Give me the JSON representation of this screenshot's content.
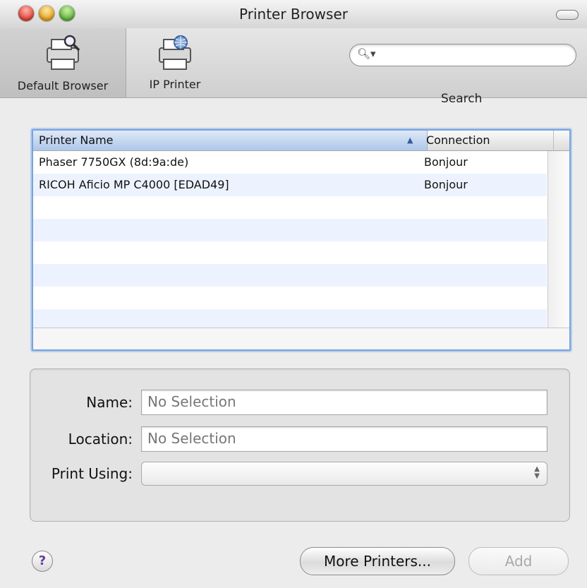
{
  "window": {
    "title": "Printer Browser"
  },
  "toolbar": {
    "default_browser": {
      "label": "Default Browser",
      "icon": "printer-magnifier-icon"
    },
    "ip_printer": {
      "label": "IP Printer",
      "icon": "printer-globe-icon"
    },
    "search": {
      "label": "Search",
      "placeholder": "",
      "icon": "search-icon"
    }
  },
  "table": {
    "columns": [
      "Printer Name",
      "Connection"
    ],
    "sort_indicator": "▲",
    "rows": [
      {
        "name": "Phaser 7750GX (8d:9a:de)",
        "connection": "Bonjour"
      },
      {
        "name": "RICOH Aficio MP C4000 [EDAD49]",
        "connection": "Bonjour"
      },
      {
        "name": "",
        "connection": ""
      },
      {
        "name": "",
        "connection": ""
      },
      {
        "name": "",
        "connection": ""
      },
      {
        "name": "",
        "connection": ""
      },
      {
        "name": "",
        "connection": ""
      },
      {
        "name": "",
        "connection": ""
      }
    ]
  },
  "details": {
    "name_label": "Name:",
    "name_value": "No Selection",
    "location_label": "Location:",
    "location_value": "No Selection",
    "print_using_label": "Print Using:",
    "print_using_value": ""
  },
  "buttons": {
    "help": "?",
    "more_printers": "More Printers...",
    "add": "Add"
  },
  "colors": {
    "selection_header": "#adc7ea",
    "table_focus_border": "#7aa3d9",
    "help_glyph": "#6a3aa0"
  }
}
